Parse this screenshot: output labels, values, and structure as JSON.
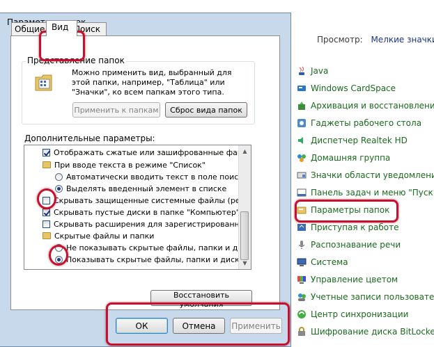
{
  "control_panel": {
    "view_label": "Просмотр:",
    "view_value": "Мелкие значки",
    "items": [
      {
        "label": "Java",
        "icon": "java-icon"
      },
      {
        "label": "Windows CardSpace",
        "icon": "cardspace-icon"
      },
      {
        "label": "Архивация и восстановление",
        "icon": "backup-icon"
      },
      {
        "label": "Гаджеты рабочего стола",
        "icon": "gadgets-icon"
      },
      {
        "label": "Диспетчер Realtek HD",
        "icon": "realtek-audio-icon"
      },
      {
        "label": "Домашняя группа",
        "icon": "homegroup-icon"
      },
      {
        "label": "Значки области уведомлений",
        "icon": "notification-icons-icon"
      },
      {
        "label": "Панель задач и меню \"Пуск\"",
        "icon": "taskbar-icon"
      },
      {
        "label": "Параметры папок",
        "icon": "folder-options-icon"
      },
      {
        "label": "Приступая к работе",
        "icon": "getting-started-icon"
      },
      {
        "label": "Распознавание речи",
        "icon": "microphone-icon"
      },
      {
        "label": "Система",
        "icon": "system-icon"
      },
      {
        "label": "Управление цветом",
        "icon": "color-management-icon"
      },
      {
        "label": "Учетные записи пользователей",
        "icon": "user-accounts-icon"
      },
      {
        "label": "Центр синхронизации",
        "icon": "sync-center-icon"
      },
      {
        "label": "Шифрование диска BitLocker",
        "icon": "bitlocker-icon"
      }
    ]
  },
  "dialog": {
    "title": "Параметры папок",
    "tabs": [
      "Общие",
      "Вид",
      "Поиск"
    ],
    "folder_view": {
      "legend": "Представление папок",
      "description": "Можно применить вид, выбранный для этой папки, например, \"Таблица\" или \"Значки\", ко всем папкам этого типа.",
      "apply_button": "Применить к папкам",
      "reset_button": "Сброс вида папок"
    },
    "advanced_label": "Дополнительные параметры:",
    "advanced_items": [
      {
        "type": "checkbox",
        "checked": true,
        "label": "Отображать сжатые или зашифрованные файлы NTF"
      },
      {
        "type": "folder",
        "label": "При вводе текста в режиме \"Список\""
      },
      {
        "type": "radio",
        "checked": false,
        "label": "Автоматически вводить текст в поле поиска"
      },
      {
        "type": "radio",
        "checked": true,
        "label": "Выделять введенный элемент в списке"
      },
      {
        "type": "checkbox",
        "checked": false,
        "label": "Скрывать защищенные системные файлы (рекомен"
      },
      {
        "type": "checkbox",
        "checked": true,
        "label": "Скрывать пустые диски в папке \"Компьютер\""
      },
      {
        "type": "checkbox",
        "checked": false,
        "label": "Скрывать расширения для зарегистрированных типо"
      },
      {
        "type": "folder",
        "label": "Скрытые файлы и папки"
      },
      {
        "type": "radio",
        "checked": false,
        "label": "Не показывать скрытые файлы, папки и диски"
      },
      {
        "type": "radio",
        "checked": true,
        "label": "Показывать скрытые файлы, папки и диски"
      }
    ],
    "restore_button": "Восстановить умолчания",
    "ok_button": "ОК",
    "cancel_button": "Отмена",
    "apply_button": "Применить"
  },
  "colors": {
    "highlight_ring": "#c8102e",
    "link_green": "#1a6a1e",
    "link_blue": "#1e3287"
  }
}
